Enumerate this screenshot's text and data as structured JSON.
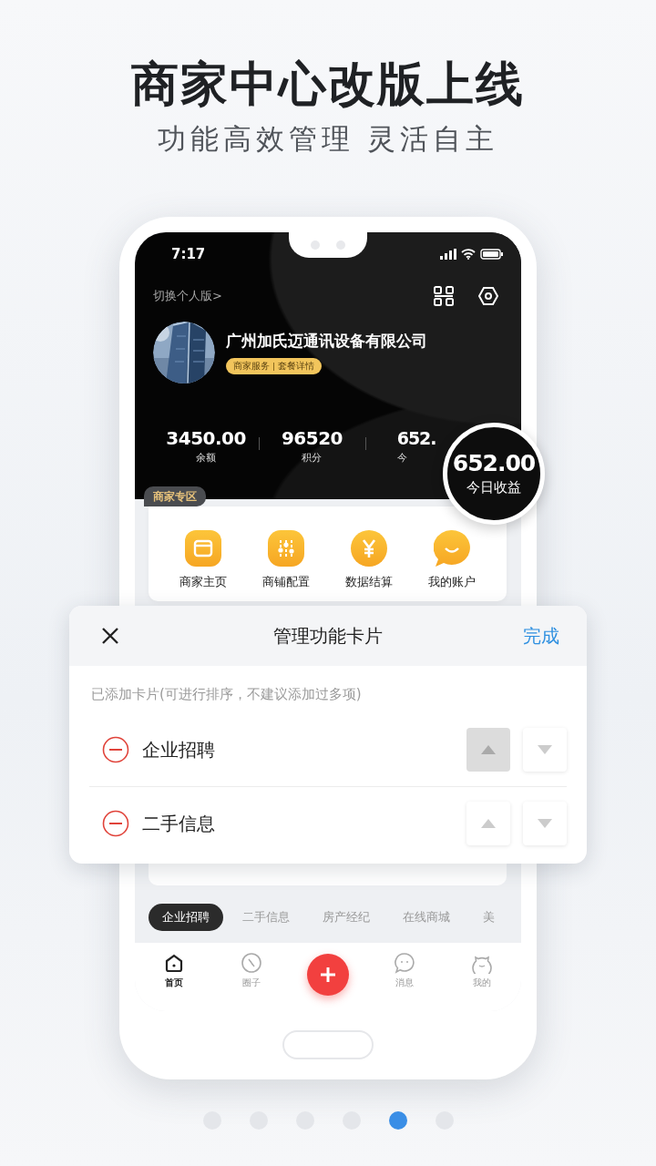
{
  "headline": {
    "title": "商家中心改版上线",
    "subtitle": "功能高效管理 灵活自主"
  },
  "status_bar": {
    "time": "7:17"
  },
  "header": {
    "switch_link": "切换个人版>",
    "company": "广州加氏迈通讯设备有限公司",
    "service_links": [
      "商家服务",
      "套餐详情"
    ]
  },
  "stats": [
    {
      "value": "3450.00",
      "label": "余额"
    },
    {
      "value": "96520",
      "label": "积分"
    },
    {
      "value": "652.",
      "label": "今"
    }
  ],
  "today_income": {
    "value": "652.00",
    "label": "今日收益"
  },
  "merchant_zone": {
    "tag": "商家专区",
    "items": [
      {
        "label": "商家主页",
        "kind": "store"
      },
      {
        "label": "商铺配置",
        "kind": "sliders"
      },
      {
        "label": "数据结算",
        "kind": "yen"
      },
      {
        "label": "我的账户",
        "kind": "smile"
      }
    ]
  },
  "manage_sheet": {
    "title": "管理功能卡片",
    "done": "完成",
    "hint": "已添加卡片(可进行排序，不建议添加过多项)",
    "cards": [
      {
        "name": "企业招聘",
        "up_disabled": true
      },
      {
        "name": "二手信息",
        "up_disabled": false
      }
    ]
  },
  "category_tabs": [
    {
      "label": "企业招聘",
      "selected": true
    },
    {
      "label": "二手信息",
      "selected": false
    },
    {
      "label": "房产经纪",
      "selected": false
    },
    {
      "label": "在线商城",
      "selected": false
    },
    {
      "label": "美",
      "selected": false
    }
  ],
  "bottom_nav": [
    {
      "kind": "home",
      "label": "首页",
      "selected": true
    },
    {
      "kind": "compass",
      "label": "圈子",
      "selected": false
    },
    {
      "kind": "add",
      "selected": false
    },
    {
      "kind": "chat",
      "label": "消息",
      "selected": false
    },
    {
      "kind": "face",
      "label": "我的",
      "selected": false
    }
  ],
  "pager": [
    {
      "selected": false
    },
    {
      "selected": false
    },
    {
      "selected": false
    },
    {
      "selected": false
    },
    {
      "selected": true
    },
    {
      "selected": false
    }
  ]
}
